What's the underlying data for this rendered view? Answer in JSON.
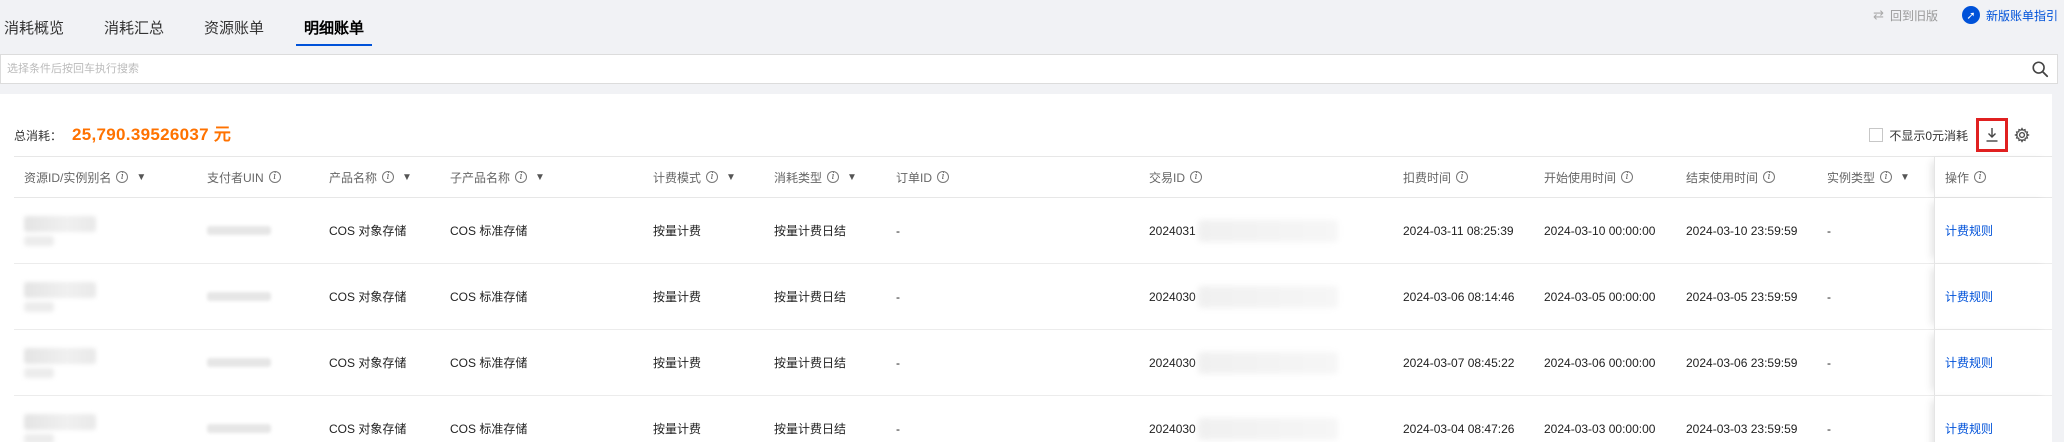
{
  "tabs": [
    {
      "label": "消耗概览",
      "active": false
    },
    {
      "label": "消耗汇总",
      "active": false
    },
    {
      "label": "资源账单",
      "active": false
    },
    {
      "label": "明细账单",
      "active": true
    }
  ],
  "top_right": {
    "old_version_label": "回到旧版",
    "new_guide_label": "新版账单指引"
  },
  "search": {
    "placeholder": "选择条件后按回车执行搜索"
  },
  "summary": {
    "label": "总消耗：",
    "value": "25,790.39526037 元"
  },
  "tools": {
    "hide_zero_label": "不显示0元消耗"
  },
  "columns": [
    {
      "label": "资源ID/实例别名",
      "info": true,
      "filter": true
    },
    {
      "label": "支付者UIN",
      "info": true,
      "filter": false
    },
    {
      "label": "产品名称",
      "info": true,
      "filter": true
    },
    {
      "label": "子产品名称",
      "info": true,
      "filter": true
    },
    {
      "label": "计费模式",
      "info": true,
      "filter": true
    },
    {
      "label": "消耗类型",
      "info": true,
      "filter": true
    },
    {
      "label": "订单ID",
      "info": true,
      "filter": false
    },
    {
      "label": "交易ID",
      "info": true,
      "filter": false
    },
    {
      "label": "扣费时间",
      "info": true,
      "filter": false
    },
    {
      "label": "开始使用时间",
      "info": true,
      "filter": false
    },
    {
      "label": "结束使用时间",
      "info": true,
      "filter": false
    },
    {
      "label": "实例类型",
      "info": true,
      "filter": true
    },
    {
      "label": "操作",
      "info": true,
      "filter": false
    }
  ],
  "rows": [
    {
      "product": "COS 对象存储",
      "sub_product": "COS 标准存储",
      "billing_mode": "按量计费",
      "consume_type": "按量计费日结",
      "order_id": "-",
      "trade_id": "2024031",
      "deduct_time": "2024-03-11 08:25:39",
      "start_time": "2024-03-10 00:00:00",
      "end_time": "2024-03-10 23:59:59",
      "instance_type": "-",
      "action": "计费规则"
    },
    {
      "product": "COS 对象存储",
      "sub_product": "COS 标准存储",
      "billing_mode": "按量计费",
      "consume_type": "按量计费日结",
      "order_id": "-",
      "trade_id": "2024030",
      "deduct_time": "2024-03-06 08:14:46",
      "start_time": "2024-03-05 00:00:00",
      "end_time": "2024-03-05 23:59:59",
      "instance_type": "-",
      "action": "计费规则"
    },
    {
      "product": "COS 对象存储",
      "sub_product": "COS 标准存储",
      "billing_mode": "按量计费",
      "consume_type": "按量计费日结",
      "order_id": "-",
      "trade_id": "2024030",
      "deduct_time": "2024-03-07 08:45:22",
      "start_time": "2024-03-06 00:00:00",
      "end_time": "2024-03-06 23:59:59",
      "instance_type": "-",
      "action": "计费规则"
    },
    {
      "product": "COS 对象存储",
      "sub_product": "COS 标准存储",
      "billing_mode": "按量计费",
      "consume_type": "按量计费日结",
      "order_id": "-",
      "trade_id": "2024030",
      "deduct_time": "2024-03-04 08:47:26",
      "start_time": "2024-03-03 00:00:00",
      "end_time": "2024-03-03 23:59:59",
      "instance_type": "-",
      "action": "计费规则"
    }
  ],
  "colors": {
    "accent": "#0052d9",
    "total_value": "#ff7200",
    "highlight_box": "#e02020"
  }
}
